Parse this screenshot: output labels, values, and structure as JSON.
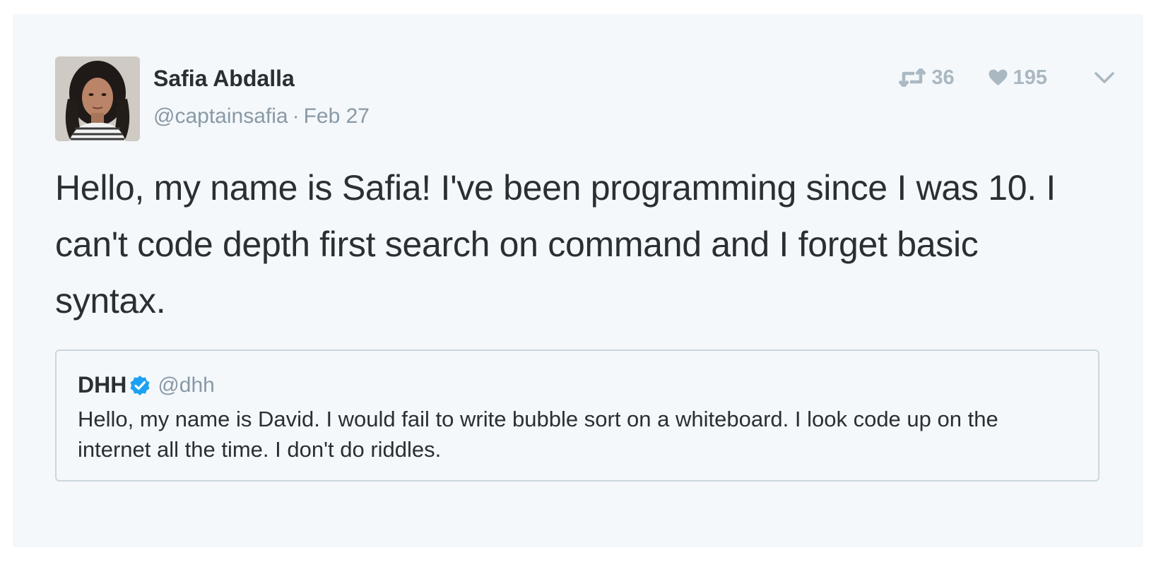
{
  "tweet": {
    "author_name": "Safia Abdalla",
    "handle": "@captainsafia",
    "separator": "·",
    "date": "Feb 27",
    "avatar_icon": "profile-photo",
    "text": "Hello, my name is Safia! I've been programming since I was 10. I can't code depth first search on command and I forget basic syntax.",
    "retweet_count": "36",
    "like_count": "195",
    "retweet_icon": "retweet-icon",
    "like_icon": "heart-icon",
    "menu_icon": "chevron-down-icon"
  },
  "quoted_tweet": {
    "author_name": "DHH",
    "verified_icon": "verified-badge-icon",
    "handle": "@dhh",
    "text": "Hello, my name is David. I would fail to write bubble sort on a whiteboard. I look code up on the internet all the time. I don't do riddles."
  },
  "colors": {
    "card_background": "#f5f8fa",
    "text_primary": "#292f33",
    "text_secondary": "#8899a6",
    "action_icon": "#aab8c2",
    "verified_blue": "#1da1f2",
    "quote_border": "#ccd6dd"
  }
}
